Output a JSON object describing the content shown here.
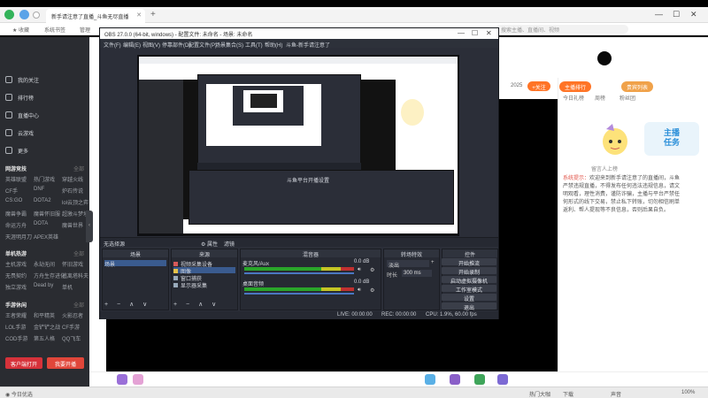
{
  "browser": {
    "tab_title": "新手请注意了直播_斗鱼无尽直播",
    "address_hint": "搜索主播、直播间、视频",
    "bookmarks": [
      "★ 收藏",
      "系统书签",
      "管理"
    ],
    "win_controls": [
      "—",
      "☐",
      "✕"
    ]
  },
  "sidebar": {
    "nav": [
      "我的关注",
      "排行榜",
      "直播中心",
      "云游戏",
      "更多"
    ],
    "sections": [
      {
        "title": "网游竞技",
        "more": "全部",
        "items": [
          "英雄联盟",
          "热门游戏",
          "穿越火线",
          "CF手",
          "DNF",
          "炉石传说",
          "CS:GO",
          "DOTA2",
          "lol云顶之弈",
          "魔兽争霸",
          "魔兽怀旧服",
          "超激斗梦境",
          "命运方舟",
          "DOTA",
          "魔兽世界",
          "天涯明月刀",
          "APEX英雄"
        ]
      },
      {
        "title": "单机热游",
        "more": "全部",
        "items": [
          "主机游戏",
          "永劫无间",
          "怀旧游戏",
          "无畏契约",
          "方舟生存进化",
          "逃离塔科夫",
          "独立游戏",
          "Dead by",
          "单机"
        ]
      },
      {
        "title": "手游休闲",
        "more": "全部",
        "items": [
          "王者荣耀",
          "和平精英",
          "火影忍者",
          "LOL手游",
          "金铲铲之战",
          "CF手游",
          "COD手游",
          "第五人格",
          "QQ飞车"
        ]
      }
    ],
    "btn_open": "客户端打开",
    "btn_live": "我要开播",
    "collapse": "‹"
  },
  "obs": {
    "title": "OBS 27.0.0 (64-bit, windows) - 配置文件: 未命名 - 场景: 未命名",
    "menu": [
      "文件(F)",
      "编辑(E)",
      "视图(V)",
      "停靠部件(D)",
      "配置文件(P)",
      "场景集合(S)",
      "工具(T)",
      "帮助(H)",
      "斗鱼-新手请注意了"
    ],
    "nested_label": "斗鱼平台开播设置",
    "toolbar_scene": "无选择源",
    "toolbar_props": "⚙ 属性",
    "toolbar_filters": "滤镜",
    "docks": {
      "scenes": {
        "title": "场景",
        "items": [
          "场景"
        ]
      },
      "sources": {
        "title": "来源",
        "items": [
          "视频采集设备",
          "图像",
          "窗口捕获",
          "显示器采集"
        ]
      },
      "mixer": {
        "title": "混音器",
        "ch1": "麦克风/Aux",
        "ch1_db": "0.0 dB",
        "ch2": "桌面音频",
        "ch2_db": "0.0 dB"
      },
      "transitions": {
        "title": "转场特效",
        "type": "淡出",
        "duration_label": "时长",
        "duration": "300 ms"
      },
      "controls": {
        "title": "控件",
        "buttons": [
          "开始推流",
          "开始录制",
          "启动虚拟摄像机",
          "工作室模式",
          "设置",
          "退出"
        ]
      }
    },
    "footer_controls": "+  −  ∧  ∨",
    "status": {
      "live": "LIVE: 00:00:00",
      "rec": "REC: 00:00:00",
      "cpu": "CPU: 1.9%, 60.00 fps"
    }
  },
  "room": {
    "tabs": [
      "主播排行",
      "贵宾列表"
    ],
    "subtabs": [
      "今日礼榜",
      "周榜",
      "粉丝团"
    ],
    "badge_line1": "主播",
    "badge_line2": "任务",
    "chibi_caption": "留言人上榜",
    "tag": "系统提示：",
    "message": "欢迎来到新手请注意了的直播间，斗鱼严禁违规直播，不得发布任何违法违规信息，请文明观看，理性消费，谨防诈骗，主播与平台严禁任何形式的线下交易，禁止私下转账，切勿相信刷单返利、帮人提现等不良信息，否则后果自负。",
    "follow_count": "2025",
    "follow_btn": "+关注"
  },
  "status_bar": {
    "left": "◉ 今日优选",
    "right": [
      "热门大咖",
      "下载",
      "声音",
      "100%"
    ]
  },
  "colors": {
    "douyu_orange": "#ff7426",
    "obs_bg": "#2b2e38",
    "sidebar_bg": "#2a2c31",
    "live_red": "#d6323a"
  }
}
